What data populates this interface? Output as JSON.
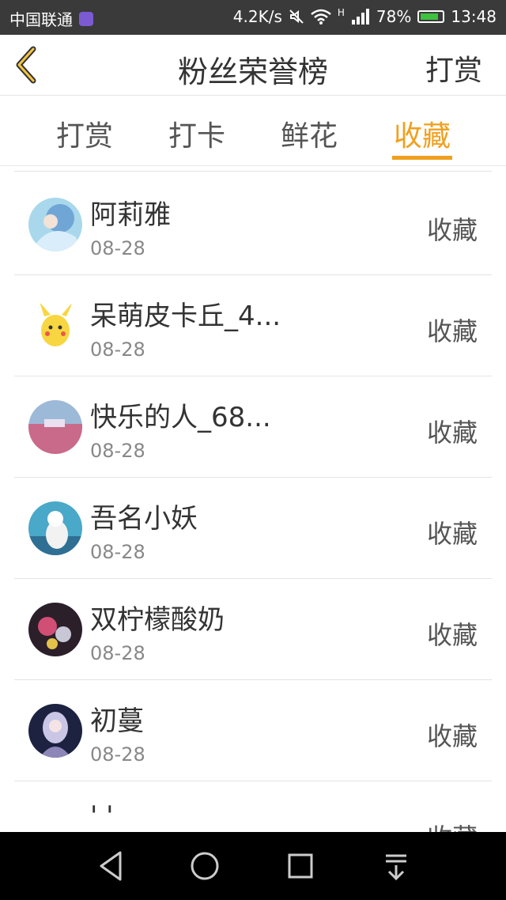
{
  "status_bar": {
    "carrier": "中国联通",
    "speed": "4.2K/s",
    "network": "H",
    "battery": "78%",
    "time": "13:48"
  },
  "header": {
    "title": "粉丝荣誉榜",
    "action": "打赏"
  },
  "tabs": [
    {
      "label": "打赏",
      "active": false
    },
    {
      "label": "打卡",
      "active": false
    },
    {
      "label": "鲜花",
      "active": false
    },
    {
      "label": "收藏",
      "active": true
    }
  ],
  "colors": {
    "accent": "#f0a01e",
    "status_bar": "#3a3a3a",
    "nav_bar": "#000000"
  },
  "fans": [
    {
      "name": "阿莉雅",
      "date": "08-28",
      "action": "收藏"
    },
    {
      "name": "呆萌皮卡丘_4...",
      "date": "08-28",
      "action": "收藏"
    },
    {
      "name": "快乐的人_68...",
      "date": "08-28",
      "action": "收藏"
    },
    {
      "name": "吾名小妖",
      "date": "08-28",
      "action": "收藏"
    },
    {
      "name": "双柠檬酸奶",
      "date": "08-28",
      "action": "收藏"
    },
    {
      "name": "初蔓",
      "date": "08-28",
      "action": "收藏"
    },
    {
      "name": "' '",
      "date": "",
      "action": "收藏"
    }
  ]
}
